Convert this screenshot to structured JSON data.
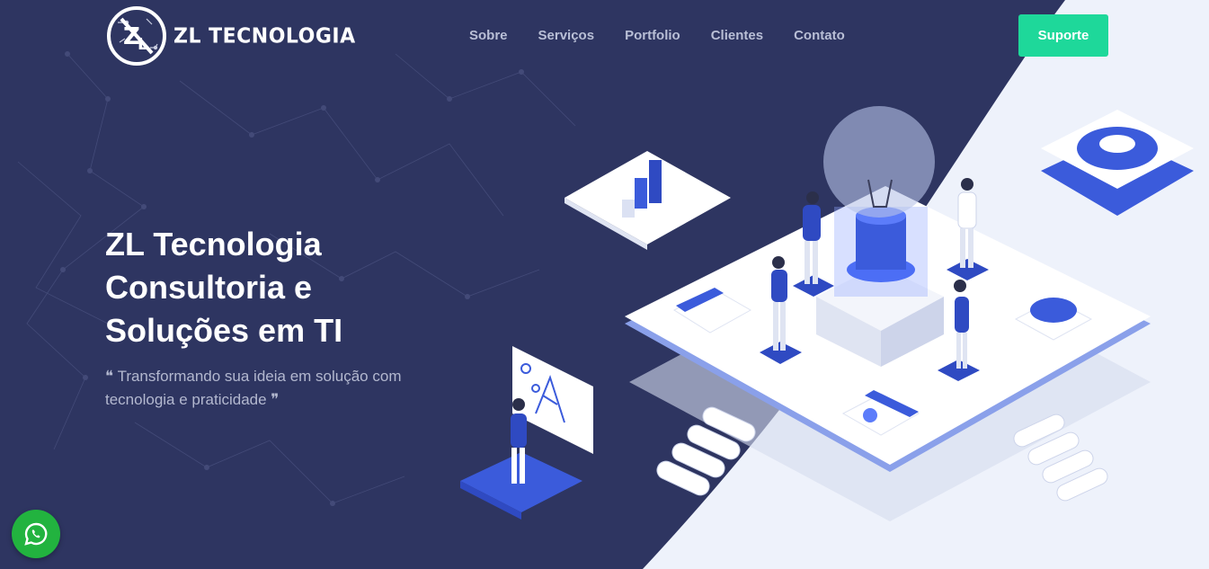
{
  "header": {
    "logo_text": "ZL TECNOLOGIA",
    "nav": [
      {
        "label": "Sobre"
      },
      {
        "label": "Serviços"
      },
      {
        "label": "Portfolio"
      },
      {
        "label": "Clientes"
      },
      {
        "label": "Contato"
      }
    ],
    "support_label": "Suporte"
  },
  "hero": {
    "title_lines": [
      "ZL Tecnologia",
      "Consultoria e",
      "Soluções em TI"
    ],
    "subtitle": "❝ Transformando sua ideia em solução com tecnologia e praticidade ❞"
  },
  "icons": {
    "whatsapp": "whatsapp-icon",
    "logo": "zl-logo-icon"
  },
  "colors": {
    "background_dark": "#2e3561",
    "background_light": "#eef2fb",
    "accent_green": "#1ed89a",
    "illustration_blue": "#3b5bdb",
    "whatsapp_green": "#22b33f"
  }
}
